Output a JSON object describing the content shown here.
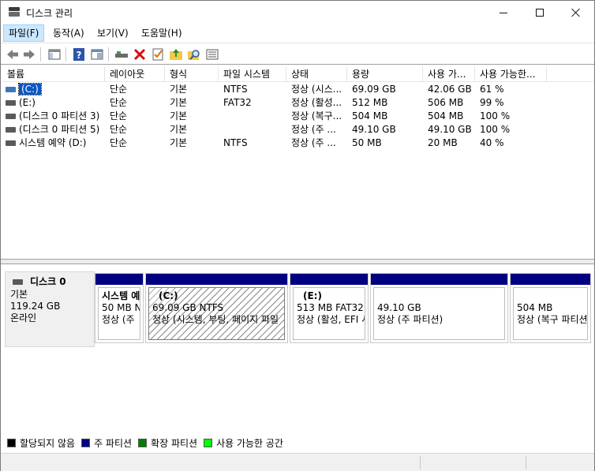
{
  "window": {
    "title": "디스크 관리"
  },
  "menu": {
    "file": "파일(F)",
    "action": "동작(A)",
    "view": "보기(V)",
    "help": "도움말(H)"
  },
  "columns": [
    "볼륨",
    "레이아웃",
    "형식",
    "파일 시스템",
    "상태",
    "용량",
    "사용 가...",
    "사용 가능한..."
  ],
  "volumes": [
    {
      "name": "(C:)",
      "layout": "단순",
      "type": "기본",
      "fs": "NTFS",
      "status": "정상 (시스...",
      "capacity": "69.09 GB",
      "free": "42.06 GB",
      "pct": "61 %"
    },
    {
      "name": "(E:)",
      "layout": "단순",
      "type": "기본",
      "fs": "FAT32",
      "status": "정상 (활성...",
      "capacity": "512 MB",
      "free": "506 MB",
      "pct": "99 %"
    },
    {
      "name": "(디스크 0 파티션 3)",
      "layout": "단순",
      "type": "기본",
      "fs": "",
      "status": "정상 (복구...",
      "capacity": "504 MB",
      "free": "504 MB",
      "pct": "100 %"
    },
    {
      "name": "(디스크 0 파티션 5)",
      "layout": "단순",
      "type": "기본",
      "fs": "",
      "status": "정상 (주 ...",
      "capacity": "49.10 GB",
      "free": "49.10 GB",
      "pct": "100 %"
    },
    {
      "name": "시스템 예약 (D:)",
      "layout": "단순",
      "type": "기본",
      "fs": "NTFS",
      "status": "정상 (주 ...",
      "capacity": "50 MB",
      "free": "20 MB",
      "pct": "40 %"
    }
  ],
  "disk": {
    "name": "디스크 0",
    "type": "기본",
    "size": "119.24 GB",
    "state": "온라인"
  },
  "partitions": [
    {
      "name": "시스템 예",
      "size": "50 MB N",
      "status": "정상 (주"
    },
    {
      "name": "(C:)",
      "size": "69.09 GB NTFS",
      "status": "정상 (시스템, 부팅, 페이지 파일"
    },
    {
      "name": "(E:)",
      "size": "513 MB FAT32",
      "status": "정상 (활성, EFI 시"
    },
    {
      "name": "",
      "size": "49.10 GB",
      "status": "정상 (주 파티션)"
    },
    {
      "name": "",
      "size": "504 MB",
      "status": "정상 (복구 파티션"
    }
  ],
  "legend": [
    {
      "label": "할당되지 않음",
      "color": "#000000"
    },
    {
      "label": "주 파티션",
      "color": "#000080"
    },
    {
      "label": "확장 파티션",
      "color": "#008000"
    },
    {
      "label": "사용 가능한 공간",
      "color": "#00ff00"
    }
  ],
  "colors": {
    "primary_bar": "#000080",
    "selection": "#0a57c2"
  },
  "icons": [
    "back-icon",
    "forward-icon",
    "console-tree-icon",
    "help-icon",
    "properties-icon",
    "connect-icon",
    "delete-icon",
    "check-icon",
    "up-folder-icon",
    "search-icon",
    "list-icon"
  ]
}
